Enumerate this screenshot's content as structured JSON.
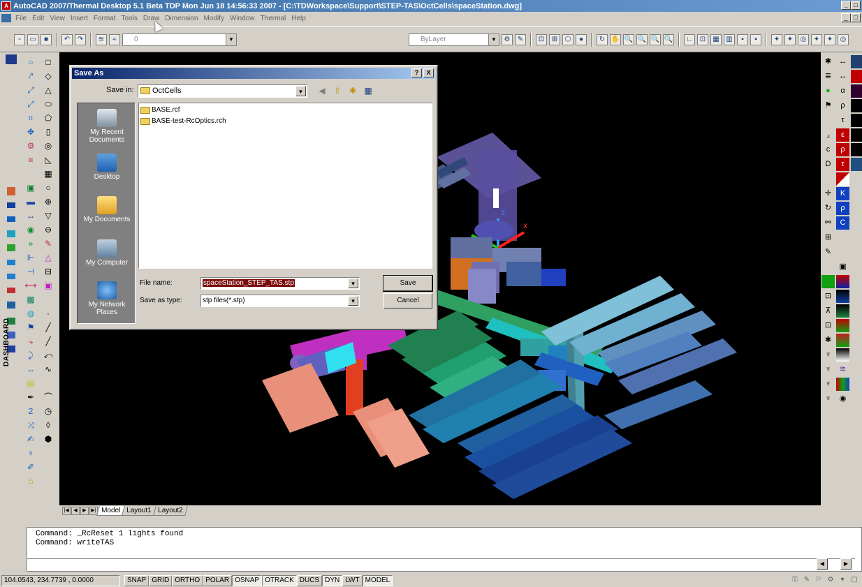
{
  "window": {
    "title": "AutoCAD 2007/Thermal Desktop 5.1 Beta TDP Mon Jun 18 14:56:33 2007 - [C:\\TDWorkspace\\Support\\STEP-TAS\\OctCells\\spaceStation.dwg]",
    "controls": [
      "_",
      "□",
      "X"
    ]
  },
  "menu": {
    "items": [
      "File",
      "Edit",
      "View",
      "Insert",
      "Format",
      "Tools",
      "Draw",
      "Dimension",
      "Modify",
      "Window",
      "Thermal",
      "Help"
    ]
  },
  "toolbar": {
    "layer_value": "0",
    "linetype_value": "ByLayer"
  },
  "dashboard_label": "DASHBOARD",
  "layout_tabs": [
    "Model",
    "Layout1",
    "Layout2"
  ],
  "command_lines": [
    "Command: _RcReset 1 lights found",
    "Command: writeTAS"
  ],
  "status": {
    "coords": "104.0543, 234.7739 , 0.0000",
    "toggles": [
      {
        "label": "SNAP",
        "on": false
      },
      {
        "label": "GRID",
        "on": false
      },
      {
        "label": "ORTHO",
        "on": false
      },
      {
        "label": "POLAR",
        "on": false
      },
      {
        "label": "OSNAP",
        "on": true
      },
      {
        "label": "OTRACK",
        "on": true
      },
      {
        "label": "DUCS",
        "on": false
      },
      {
        "label": "DYN",
        "on": true
      },
      {
        "label": "LWT",
        "on": false
      },
      {
        "label": "MODEL",
        "on": true
      }
    ]
  },
  "dialog": {
    "title": "Save As",
    "title_buttons": [
      "?",
      "X"
    ],
    "save_in_label": "Save in:",
    "save_in_value": "OctCells",
    "places": [
      "My Recent Documents",
      "Desktop",
      "My Documents",
      "My Computer",
      "My Network Places"
    ],
    "files": [
      "BASE.rcf",
      "BASE-test-RcOptics.rch"
    ],
    "file_name_label": "File name:",
    "file_name_value": "spaceStation_STEP_TAS.stp",
    "save_type_label": "Save as type:",
    "save_type_value": "stp files(*.stp)",
    "save_button": "Save",
    "cancel_button": "Cancel"
  },
  "colors": {
    "title_gradient_start": "#0a246a",
    "viewport_bg": "#000000",
    "filename_highlight": "#7a0a0a"
  }
}
